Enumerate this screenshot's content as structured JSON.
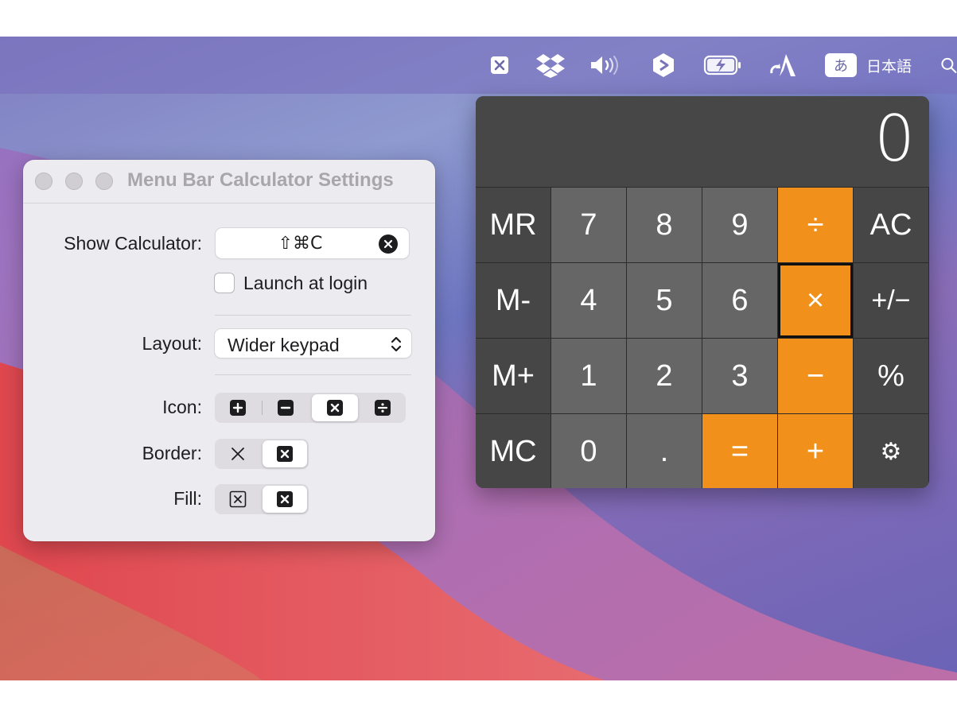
{
  "menubar": {
    "icons": [
      "calculator-icon",
      "dropbox-icon",
      "volume-icon",
      "shortcuts-icon",
      "battery-charging-icon",
      "text-tool-icon",
      "input-method-icon",
      "search-icon"
    ],
    "input_method_glyph": "あ",
    "input_method_label": "日本語"
  },
  "settings": {
    "title": "Menu Bar Calculator Settings",
    "show_calculator_label": "Show Calculator:",
    "shortcut_value": "⇧⌘C",
    "launch_at_login_label": "Launch at login",
    "launch_at_login_checked": false,
    "layout_label": "Layout:",
    "layout_value": "Wider keypad",
    "icon_label": "Icon:",
    "icon_options": [
      "plus",
      "minus",
      "multiply",
      "divide"
    ],
    "icon_selected": "multiply",
    "border_label": "Border:",
    "border_options": [
      "no-border",
      "border"
    ],
    "border_selected": "border",
    "fill_label": "Fill:",
    "fill_options": [
      "outline",
      "filled"
    ],
    "fill_selected": "filled"
  },
  "calculator": {
    "display": "0",
    "keys": [
      [
        "MR",
        "7",
        "8",
        "9",
        "÷",
        "AC"
      ],
      [
        "M-",
        "4",
        "5",
        "6",
        "×",
        "+/−"
      ],
      [
        "M+",
        "1",
        "2",
        "3",
        "−",
        "%"
      ],
      [
        "MC",
        "0",
        ".",
        "=",
        "+",
        "⚙"
      ]
    ],
    "highlighted_key": "×",
    "colors": {
      "memory": "#464646",
      "number": "#666666",
      "operator": "#f1901b",
      "display": "#474747"
    }
  }
}
